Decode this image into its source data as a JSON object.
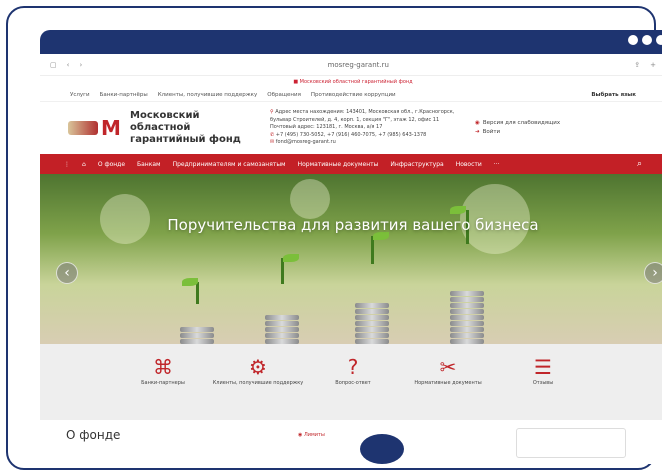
{
  "browser": {
    "url": "mosreg-garant.ru"
  },
  "notice": "Московский областной гарантийный фонд",
  "topnav": {
    "items": [
      "Услуги",
      "Банки-партнёры",
      "Клиенты, получившие поддержку",
      "Обращения",
      "Противодействие коррупции"
    ],
    "lang": "Выбрать язык"
  },
  "header": {
    "org_name": "Московский областной гарантийный фонд",
    "address": "Адрес места нахождения: 143401, Московская обл., г.Красногорск, бульвар Строителей, д. 4, корп. 1, секция \"Г\", этаж 12, офис 11",
    "postal": "Почтовый адрес: 123181, г. Москва, а/я 17",
    "phones": "+7 (495) 730-5052, +7 (916) 460-7075, +7 (985) 643-1378",
    "email": "fond@mosreg-garant.ru",
    "links": [
      "Версия для слабовидящих",
      "Войти"
    ]
  },
  "mainnav": {
    "items": [
      "О фонде",
      "Банкам",
      "Предпринимателям и самозанятым",
      "Нормативные документы",
      "Инфраструктура",
      "Новости",
      "···"
    ]
  },
  "hero": {
    "title": "Поручительства для развития вашего бизнеса"
  },
  "tiles": [
    {
      "label": "Банки-партнеры",
      "icon": "chip-icon"
    },
    {
      "label": "Клиенты, получившие поддержку",
      "icon": "gears-icon"
    },
    {
      "label": "Вопрос-ответ",
      "icon": "faq-icon"
    },
    {
      "label": "Нормативные документы",
      "icon": "tools-icon"
    },
    {
      "label": "Отзывы",
      "icon": "reviews-icon"
    }
  ],
  "bottom": {
    "about": "О фонде",
    "pay": "Лимиты"
  },
  "colors": {
    "brand_red": "#c32026",
    "frame_blue": "#1e3470"
  }
}
